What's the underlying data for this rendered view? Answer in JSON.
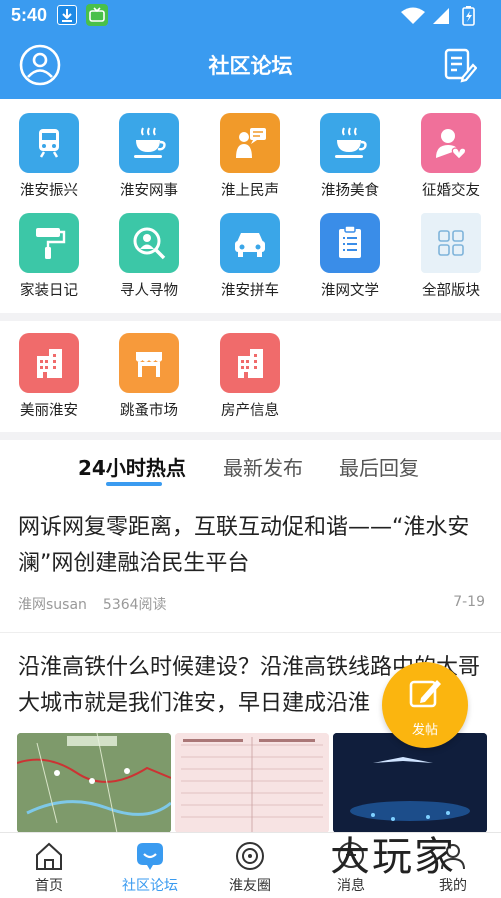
{
  "status_bar": {
    "time": "5:40"
  },
  "header": {
    "title": "社区论坛"
  },
  "grid": [
    {
      "label": "淮安振兴",
      "icon": "train-icon",
      "color": "#3aa6e8"
    },
    {
      "label": "淮安网事",
      "icon": "coffee-icon",
      "color": "#3aa6e8"
    },
    {
      "label": "淮上民声",
      "icon": "speaker-icon",
      "color": "#f19a2a"
    },
    {
      "label": "淮扬美食",
      "icon": "coffee-icon",
      "color": "#3aa6e8"
    },
    {
      "label": "征婚交友",
      "icon": "heart-user-icon",
      "color": "#f0709a"
    },
    {
      "label": "家装日记",
      "icon": "paint-roller-icon",
      "color": "#3cc7a7"
    },
    {
      "label": "寻人寻物",
      "icon": "search-person-icon",
      "color": "#3cc7a7"
    },
    {
      "label": "淮安拼车",
      "icon": "car-icon",
      "color": "#3aa6e8"
    },
    {
      "label": "淮网文学",
      "icon": "document-icon",
      "color": "#3a8de8"
    },
    {
      "label": "全部版块",
      "icon": "grid-icon",
      "color": "#e7f1f8"
    }
  ],
  "grid2": [
    {
      "label": "美丽淮安",
      "icon": "building-icon",
      "color": "#f06b6b"
    },
    {
      "label": "跳蚤市场",
      "icon": "shop-icon",
      "color": "#f79a3b"
    },
    {
      "label": "房产信息",
      "icon": "building-icon",
      "color": "#f06b6b"
    }
  ],
  "tabs": [
    {
      "label": "24小时热点"
    },
    {
      "label": "最新发布"
    },
    {
      "label": "最后回复"
    }
  ],
  "posts": [
    {
      "title": "网诉网复零距离，互联互动促和谐——“淮水安澜”网创建融洽民生平台",
      "author": "淮网susan",
      "views": "5364阅读",
      "date": "7-19"
    },
    {
      "title": "沿淮高铁什么时候建设？沿淮高铁线路中的大哥大城市就是我们淮安，早日建成沿淮"
    }
  ],
  "fab": {
    "label": "发帖"
  },
  "bottom_nav": [
    {
      "label": "首页",
      "icon": "home-icon"
    },
    {
      "label": "社区论坛",
      "icon": "forum-icon"
    },
    {
      "label": "淮友圈",
      "icon": "circle-icon"
    },
    {
      "label": "消息",
      "icon": "message-icon"
    },
    {
      "label": "我的",
      "icon": "user-icon"
    }
  ],
  "watermark": "大玩家",
  "colors": {
    "primary": "#3a9bf0",
    "fab": "#fbb50f"
  }
}
